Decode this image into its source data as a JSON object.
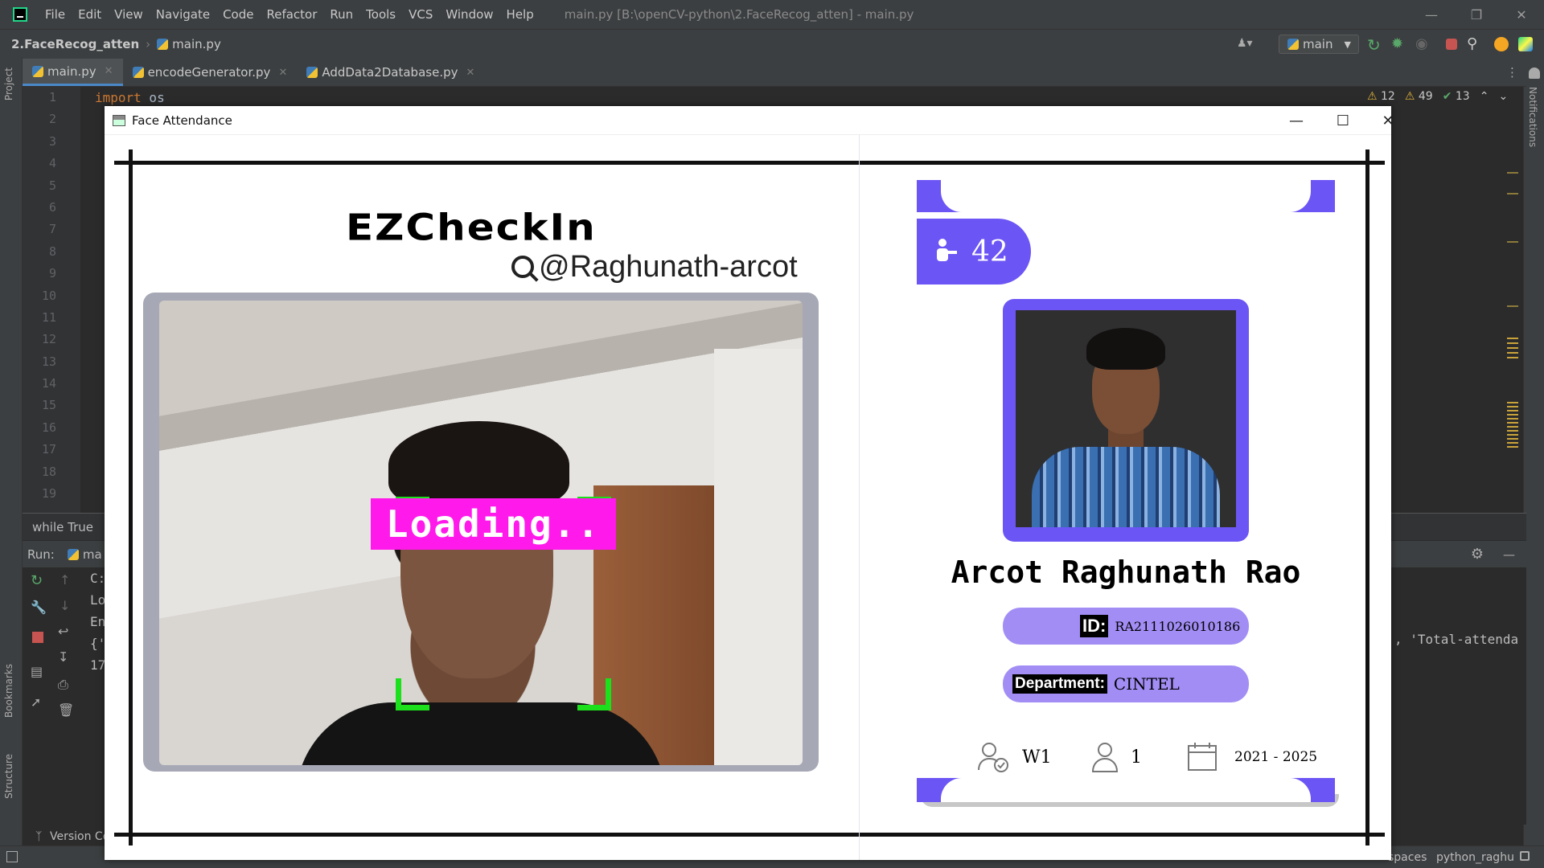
{
  "ide": {
    "menu": [
      "File",
      "Edit",
      "View",
      "Navigate",
      "Code",
      "Refactor",
      "Run",
      "Tools",
      "VCS",
      "Window",
      "Help"
    ],
    "window_title": "main.py [B:\\openCV-python\\2.FaceRecog_atten] - main.py",
    "project": "2.FaceRecog_atten",
    "nav_file": "main.py",
    "run_config": "main",
    "tabs": [
      {
        "label": "main.py"
      },
      {
        "label": "encodeGenerator.py"
      },
      {
        "label": "AddData2Database.py"
      }
    ],
    "line_numbers": [
      "1",
      "2",
      "3",
      "4",
      "5",
      "6",
      "7",
      "8",
      "9",
      "10",
      "11",
      "12",
      "13",
      "14",
      "15",
      "16",
      "17",
      "18",
      "19"
    ],
    "code_first_kw": "import",
    "code_first_rest": " os",
    "inspections": {
      "warnings": "12",
      "weak_warnings": "49",
      "ok": "13"
    },
    "breadcrumb": "while True",
    "run_label": "Run:",
    "run_tab": "ma",
    "run_output": [
      "C:",
      "Lo",
      "En",
      "{'",
      "17"
    ],
    "right_output": ", 'Total-attenda",
    "left_labels": {
      "project": "Project",
      "bookmarks": "Bookmarks",
      "structure": "Structure"
    },
    "right_label": "Notifications",
    "status_left": "Version Co",
    "status_right": [
      "spaces",
      "python_raghu"
    ]
  },
  "app": {
    "title": "Face Attendance",
    "brand": "EZCheckIn",
    "handle": "@Raghunath-arcot",
    "loading": "Loading..",
    "count": "42",
    "name": "Arcot Raghunath Rao",
    "id_label": "ID:",
    "id_value": "RA2111026010186",
    "dept_label": "Department:",
    "dept_value": "CINTEL",
    "section": "W1",
    "attendance": "1",
    "years": "2021 - 2025",
    "colors": {
      "accent": "#6c55f5",
      "pill": "#a28df5",
      "loading_bg": "#ff19ea",
      "detect": "#1de01d"
    }
  }
}
